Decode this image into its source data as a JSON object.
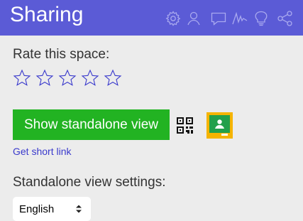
{
  "header": {
    "title": "Sharing",
    "background": "#5b5bd6",
    "icons": [
      "settings-gear-icon",
      "person-icon",
      "comment-icon",
      "signature-icon",
      "lightbulb-icon",
      "share-icon"
    ]
  },
  "rating": {
    "label": "Rate this space:",
    "stars_total": 5,
    "stars_filled": 0,
    "star_color": "#3a3acc"
  },
  "standalone": {
    "button_label": "Show standalone view",
    "button_color": "#22b322",
    "qr_icon": "qr-code-icon",
    "classroom_icon": "google-classroom-icon"
  },
  "short_link": {
    "label": "Get short link",
    "color": "#3a3acc"
  },
  "settings": {
    "label": "Standalone view settings:",
    "language_selected": "English"
  }
}
